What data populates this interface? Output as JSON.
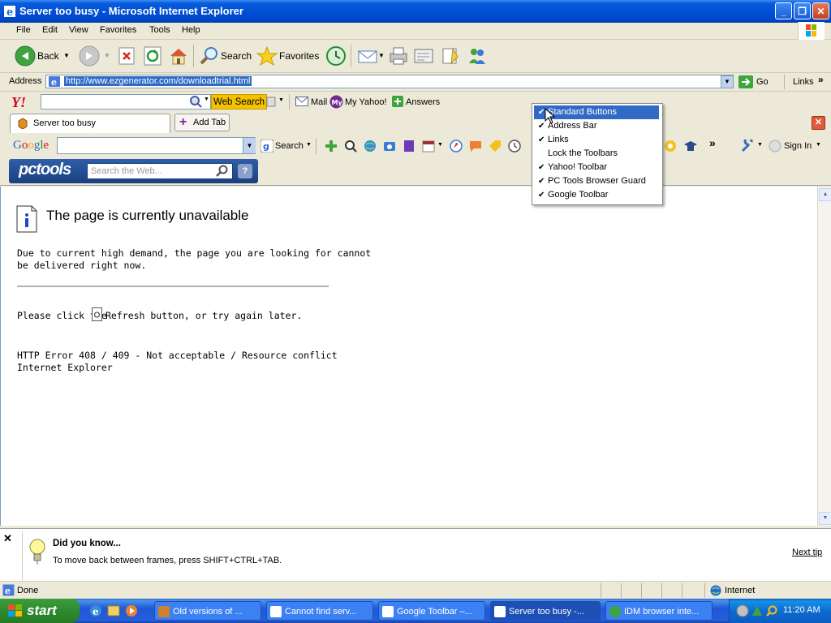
{
  "window": {
    "title": "Server too busy - Microsoft Internet Explorer"
  },
  "menu": [
    "File",
    "Edit",
    "View",
    "Favorites",
    "Tools",
    "Help"
  ],
  "toolbar": {
    "back": "Back",
    "search": "Search",
    "favorites": "Favorites"
  },
  "address": {
    "label": "Address",
    "url": "http://www.ezgenerator.com/downloadtrial.html",
    "go": "Go",
    "links": "Links"
  },
  "yahoo": {
    "search_button": "Web Search",
    "mail": "Mail",
    "my_yahoo": "My Yahoo!",
    "answers": "Answers"
  },
  "tabs": {
    "active_label": "Server too busy",
    "add_tab": "Add Tab"
  },
  "google": {
    "search": "Search",
    "sign_in": "Sign In"
  },
  "pctools": {
    "placeholder": "Search the Web..."
  },
  "page": {
    "heading": "The page is currently unavailable",
    "line1": "Due to current high demand, the page you are looking for cannot",
    "line2": "be delivered right now.",
    "refresh_before": "Please click the",
    "refresh_after": "Refresh button, or try again later.",
    "error": "HTTP Error 408 / 409 - Not acceptable / Resource conflict",
    "product": "Internet Explorer"
  },
  "tip": {
    "title": "Did you know...",
    "text": "To move back between frames, press SHIFT+CTRL+TAB.",
    "next": "Next tip"
  },
  "status": {
    "left": "Done",
    "zone": "Internet"
  },
  "taskbar": {
    "start": "start",
    "tasks": [
      "Old versions of ...",
      "Cannot find serv...",
      "Google Toolbar –...",
      "Server too busy -...",
      "IDM browser inte..."
    ],
    "clock": "11:20 AM"
  },
  "dropdown": [
    {
      "label": "Standard Buttons",
      "checked": true
    },
    {
      "label": "Address Bar",
      "checked": true
    },
    {
      "label": "Links",
      "checked": true
    },
    {
      "label": "Lock the Toolbars",
      "checked": false
    },
    {
      "label": "Yahoo! Toolbar",
      "checked": true
    },
    {
      "label": "PC Tools Browser Guard",
      "checked": true
    },
    {
      "label": "Google Toolbar",
      "checked": true
    }
  ]
}
